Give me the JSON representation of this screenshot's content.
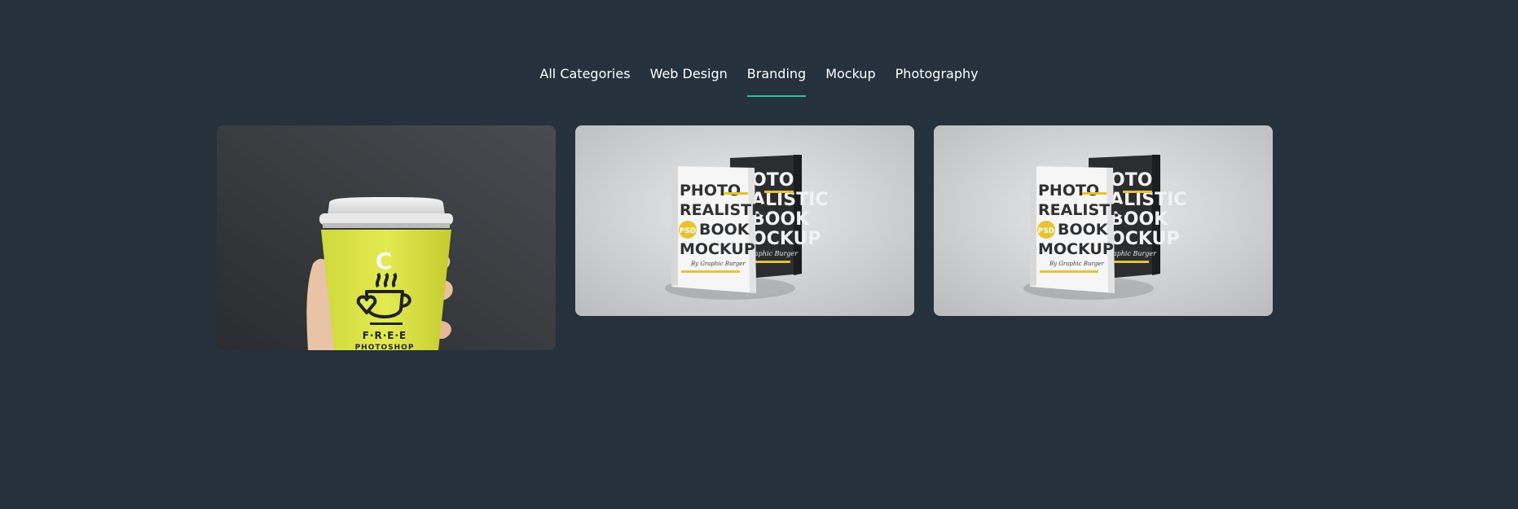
{
  "filter_tabs": [
    {
      "label": "All Categories",
      "active": false
    },
    {
      "label": "Web Design",
      "active": false
    },
    {
      "label": "Branding",
      "active": true
    },
    {
      "label": "Mockup",
      "active": false
    },
    {
      "label": "Photography",
      "active": false
    }
  ],
  "accent_color": "#28c3a0",
  "background_color": "#25313c",
  "portfolio_items": [
    {
      "image": "coffee-cup-mockup",
      "cup_text": {
        "letter": "C",
        "line1": "F·R·E·E",
        "line2": "PHOTOSHOP"
      }
    },
    {
      "image": "book-mockup",
      "front_cover": {
        "line1": "PHOTO",
        "line2": "REALISTIC",
        "badge": "PSD",
        "line3": "BOOK",
        "line4": "MOCKUP",
        "byline": "By Graphic Burger"
      },
      "back_cover": {
        "line1": "OTO",
        "line2": "ALISTIC",
        "line3": "BOOK",
        "line4": "OCKUP",
        "byline": "raphic Burger"
      }
    },
    {
      "image": "book-mockup",
      "front_cover": {
        "line1": "PHOTO",
        "line2": "REALISTIC",
        "badge": "PSD",
        "line3": "BOOK",
        "line4": "MOCKUP",
        "byline": "By Graphic Burger"
      },
      "back_cover": {
        "line1": "OTO",
        "line2": "ALISTIC",
        "line3": "BOOK",
        "line4": "OCKUP",
        "byline": "raphic Burger"
      }
    }
  ]
}
